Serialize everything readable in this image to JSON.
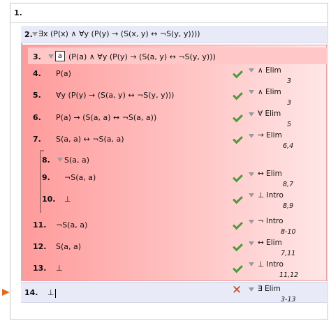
{
  "proof": {
    "line1": {
      "num": "1."
    },
    "line2": {
      "num": "2.",
      "formula": "∃x (P(x) ∧ ∀y (P(y) → (S(x, y) ↔ ¬S(y, y))))"
    },
    "line3": {
      "num": "3.",
      "box_label": "a",
      "formula": "(P(a) ∧ ∀y (P(y)  → (S(a, y)   ↔ ¬S(y, y)))"
    },
    "line4": {
      "num": "4.",
      "formula": "P(a)",
      "rule": "∧ Elim",
      "refs": "3"
    },
    "line5": {
      "num": "5.",
      "formula": "∀y (P(y) → (S(a, y) ↔ ¬S(y, y)))",
      "rule": "∧ Elim",
      "refs": "3"
    },
    "line6": {
      "num": "6.",
      "formula": "P(a) → (S(a, a) ↔ ¬S(a, a))",
      "rule": "∀ Elim",
      "refs": "5"
    },
    "line7": {
      "num": "7.",
      "formula": "S(a, a) ↔ ¬S(a, a)",
      "rule": "→ Elim",
      "refs": "6,4"
    },
    "line8": {
      "num": "8.",
      "formula": "S(a, a)"
    },
    "line9": {
      "num": "9.",
      "formula": "¬S(a, a)",
      "rule": "↔ Elim",
      "refs": "8,7"
    },
    "line10": {
      "num": "10.",
      "formula": "⊥",
      "rule": "⊥ Intro",
      "refs": "8,9"
    },
    "line11": {
      "num": "11.",
      "formula": "¬S(a, a)",
      "rule": "¬ Intro",
      "refs": "8-10"
    },
    "line12": {
      "num": "12.",
      "formula": "S(a, a)",
      "rule": "↔ Elim",
      "refs": "7,11"
    },
    "line13": {
      "num": "13.",
      "formula": "⊥",
      "rule": "⊥ Intro",
      "refs": "11,12"
    },
    "line14": {
      "num": "14.",
      "formula": "⊥",
      "rule": "∃ Elim",
      "refs": "3-13"
    }
  },
  "colors": {
    "subproof_red": "#ff9b9b",
    "check_green": "#4c9a3c",
    "cross_red": "#c24a2c",
    "focus_arrow": "#e06d1e",
    "selected_row": "#e8ebf7"
  },
  "icons": {
    "check": "check-icon",
    "cross": "cross-icon",
    "collapse": "triangle-down-icon",
    "focus": "arrow-right-icon"
  }
}
